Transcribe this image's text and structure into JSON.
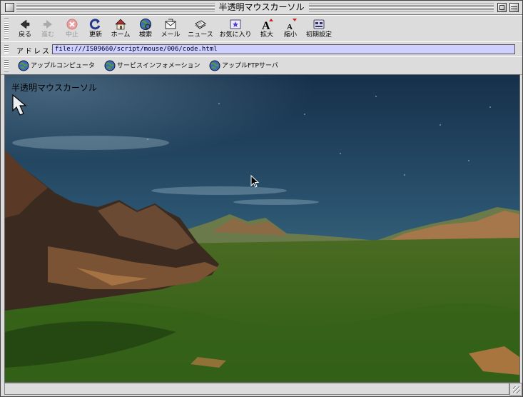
{
  "window": {
    "title": "半透明マウスカーソル"
  },
  "toolbar": {
    "buttons": [
      {
        "label": "戻る",
        "icon": "back-arrow-icon",
        "enabled": true
      },
      {
        "label": "進む",
        "icon": "forward-arrow-icon",
        "enabled": false
      },
      {
        "label": "中止",
        "icon": "stop-icon",
        "enabled": false
      },
      {
        "label": "更新",
        "icon": "refresh-icon",
        "enabled": true
      },
      {
        "label": "ホーム",
        "icon": "home-icon",
        "enabled": true
      },
      {
        "label": "検索",
        "icon": "search-globe-icon",
        "enabled": true
      },
      {
        "label": "メール",
        "icon": "mail-icon",
        "enabled": true
      },
      {
        "label": "ニュース",
        "icon": "news-icon",
        "enabled": true
      },
      {
        "label": "お気に入り",
        "icon": "favorites-icon",
        "enabled": true
      },
      {
        "label": "拡大",
        "icon": "larger-text-icon",
        "enabled": true
      },
      {
        "label": "縮小",
        "icon": "smaller-text-icon",
        "enabled": true
      },
      {
        "label": "初期設定",
        "icon": "preferences-icon",
        "enabled": true
      }
    ]
  },
  "address": {
    "label": "アドレス：",
    "url": "file:///IS09660/script/mouse/006/code.html"
  },
  "favorites_bar": {
    "items": [
      {
        "label": "アップルコンピュータ",
        "icon": "globe-icon"
      },
      {
        "label": "サービスインフォメーション",
        "icon": "globe-icon"
      },
      {
        "label": "アップルFTPサーバ",
        "icon": "globe-icon"
      }
    ]
  },
  "page": {
    "heading": "半透明マウスカーソル",
    "background": "landscape-sky-mountains-grassland",
    "cursor_large": "translucent-arrow-cursor-icon",
    "cursor_small": "arrow-cursor-icon"
  },
  "colors": {
    "url_field_bg": "#cfd0ff",
    "sky_top": "#15314b",
    "grass": "#3d6a1a",
    "chrome": "#dcdcdc"
  }
}
